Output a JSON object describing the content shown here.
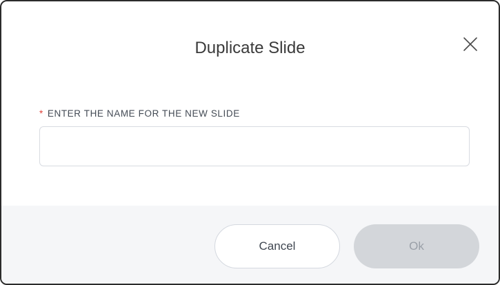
{
  "dialog": {
    "title": "Duplicate Slide",
    "close_icon": "close-icon"
  },
  "form": {
    "required_marker": "*",
    "label": "ENTER THE NAME FOR THE NEW SLIDE",
    "name_value": "",
    "name_placeholder": ""
  },
  "footer": {
    "cancel_label": "Cancel",
    "ok_label": "Ok",
    "ok_disabled": true
  },
  "colors": {
    "required": "#e0423a",
    "ok_disabled_bg": "#d3d6da",
    "footer_bg": "#f5f6f8"
  }
}
